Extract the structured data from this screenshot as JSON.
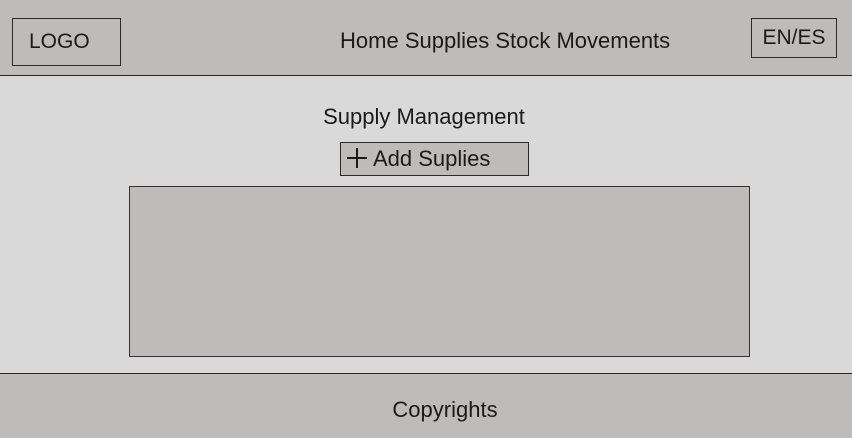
{
  "header": {
    "logo": "LOGO",
    "nav": {
      "home": "Home",
      "supplies": "Supplies",
      "stock_movements": "Stock Movements"
    },
    "language_toggle": "EN/ES"
  },
  "main": {
    "title": "Supply Management",
    "add_button_label": "Add Suplies",
    "add_button_icon": "plus-icon"
  },
  "footer": {
    "copyright": "Copyrights"
  },
  "colors": {
    "bars": "#bdbcbb",
    "page": "#d9d9d9",
    "border": "#2a2a2a"
  }
}
